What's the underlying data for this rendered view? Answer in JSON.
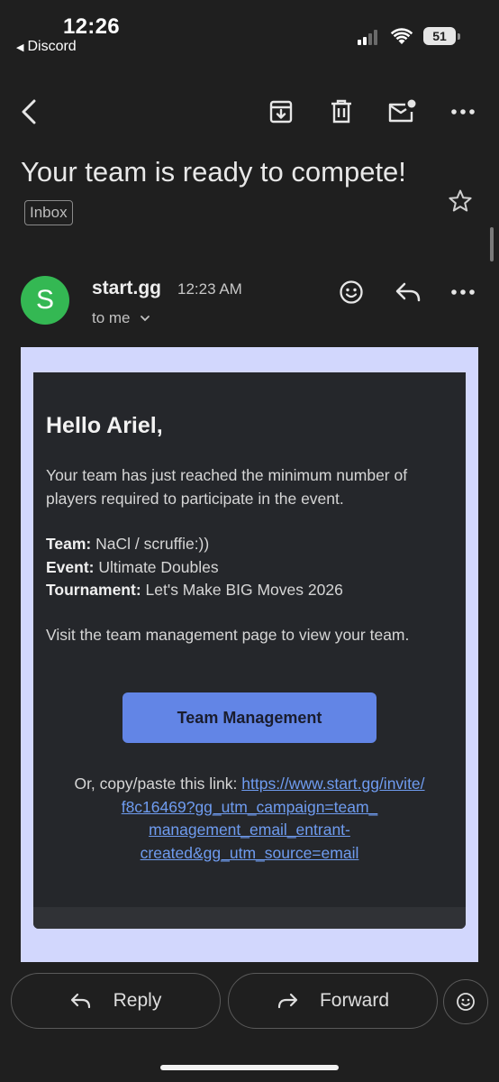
{
  "status_bar": {
    "time": "12:26",
    "back_app": "Discord",
    "battery": "51"
  },
  "email": {
    "subject": "Your team is ready to compete!",
    "label": "Inbox",
    "sender": "start.gg",
    "sender_initial": "S",
    "time": "12:23 AM",
    "recipient": "to me"
  },
  "body": {
    "greeting": "Hello Ariel,",
    "intro": "Your team has just reached the minimum number of players required to participate in the event.",
    "team_label": "Team:",
    "team_value": "NaCl / scruffie:))",
    "event_label": "Event:",
    "event_value": "Ultimate Doubles",
    "tournament_label": "Tournament:",
    "tournament_value": "Let's Make BIG Moves 2026",
    "visit_text": "Visit the team management page to view your team.",
    "cta_label": "Team Management",
    "link_prefix": "Or, copy/paste this link:",
    "link_url": "https://www.start.gg/invite/f8c16469?gg_utm_campaign=team_management_email_entrant-created&gg_utm_source=email"
  },
  "actions": {
    "reply": "Reply",
    "forward": "Forward"
  },
  "colors": {
    "background": "#1f1f1f",
    "avatar": "#34b853",
    "email_frame": "#d2d7fd",
    "email_card": "#25272b",
    "cta": "#6285e6",
    "link": "#6f9cf0"
  },
  "icons": [
    "back-arrow-icon",
    "archive-icon",
    "delete-icon",
    "mark-unread-icon",
    "more-icon",
    "star-icon",
    "emoji-icon",
    "reply-icon",
    "chevron-down-icon",
    "forward-icon"
  ]
}
